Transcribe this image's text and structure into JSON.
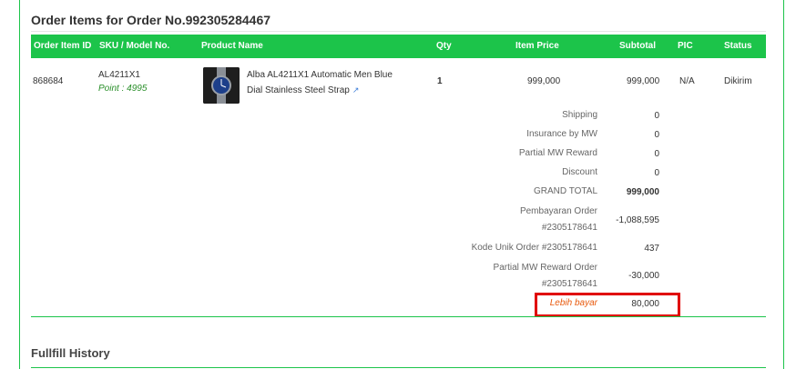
{
  "order": {
    "title": "Order Items for Order No.992305284467"
  },
  "table": {
    "headers": [
      "Order Item ID",
      "SKU / Model No.",
      "Product Name",
      "Qty",
      "Item Price",
      "Subtotal",
      "PIC",
      "Status"
    ],
    "row": {
      "item_id": "868684",
      "sku": "AL4211X1",
      "point": "Point : 4995",
      "product_name_line1": "Alba AL4211X1 Automatic Men Blue",
      "product_name_line2": "Dial Stainless Steel Strap",
      "qty": "1",
      "item_price": "999,000",
      "subtotal": "999,000",
      "pic": "N/A",
      "status": "Dikirim"
    }
  },
  "summary": [
    {
      "label": "Shipping",
      "value": "0"
    },
    {
      "label": "Insurance by MW",
      "value": "0"
    },
    {
      "label": "Partial MW Reward",
      "value": "0"
    },
    {
      "label": "Discount",
      "value": "0"
    },
    {
      "label": "GRAND TOTAL",
      "value": "999,000"
    },
    {
      "label_line1": "Pembayaran Order",
      "label_line2": "#2305178641",
      "value": "-1,088,595"
    },
    {
      "label": "Kode Unik Order #2305178641",
      "value": "437"
    },
    {
      "label_line1": "Partial MW Reward Order",
      "label_line2": "#2305178641",
      "value": "-30,000"
    },
    {
      "label": "Lebih bayar",
      "value": "80,000"
    }
  ],
  "history": {
    "title": "Fullfill History"
  },
  "icons": {
    "external_link": "external-link-icon",
    "product_thumbnail": "watch-image"
  },
  "colors": {
    "header_green": "#1cc44a",
    "highlight_red": "#e00000",
    "lebih_bayar_orange": "#e8590c"
  }
}
